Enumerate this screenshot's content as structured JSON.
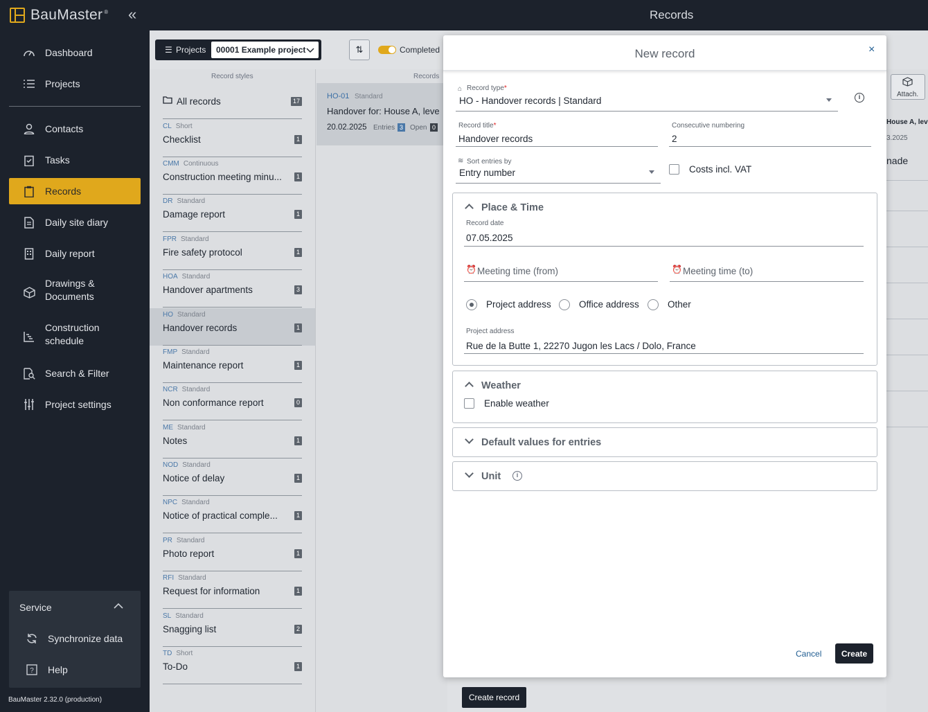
{
  "app": {
    "name": "BauMaster",
    "page_title": "Records",
    "version": "BauMaster 2.32.0 (production)"
  },
  "sidebar": {
    "items": [
      {
        "label": "Dashboard",
        "icon": "gauge-icon"
      },
      {
        "label": "Projects",
        "icon": "list-icon"
      },
      {
        "label": "Contacts",
        "icon": "person-icon"
      },
      {
        "label": "Tasks",
        "icon": "clipboard-check-icon"
      },
      {
        "label": "Records",
        "icon": "clipboard-icon",
        "active": true
      },
      {
        "label": "Daily site diary",
        "icon": "document-icon"
      },
      {
        "label": "Daily report",
        "icon": "building-icon"
      },
      {
        "label": "Drawings &",
        "label2": "Documents",
        "icon": "cube-icon"
      },
      {
        "label": "Construction",
        "label2": "schedule",
        "icon": "chart-icon"
      },
      {
        "label": "Search & Filter",
        "icon": "search-document-icon"
      },
      {
        "label": "Project settings",
        "icon": "sliders-icon"
      }
    ],
    "service": {
      "title": "Service",
      "items": [
        {
          "label": "Synchronize data"
        },
        {
          "label": "Help"
        }
      ]
    }
  },
  "toolbar": {
    "projects_label": "Projects",
    "project_value": "00001 Example project",
    "completed_label": "Completed"
  },
  "columns": {
    "styles_header": "Record styles",
    "records_header": "Records"
  },
  "record_styles": [
    {
      "code": "",
      "kind": "",
      "name": "All records",
      "count": "17"
    },
    {
      "code": "CL",
      "kind": "Short",
      "name": "Checklist",
      "count": "1"
    },
    {
      "code": "CMM",
      "kind": "Continuous",
      "name": "Construction meeting minu...",
      "count": "1"
    },
    {
      "code": "DR",
      "kind": "Standard",
      "name": "Damage report",
      "count": "1"
    },
    {
      "code": "FPR",
      "kind": "Standard",
      "name": "Fire safety protocol",
      "count": "1"
    },
    {
      "code": "HOA",
      "kind": "Standard",
      "name": "Handover apartments",
      "count": "3"
    },
    {
      "code": "HO",
      "kind": "Standard",
      "name": "Handover records",
      "count": "1"
    },
    {
      "code": "FMP",
      "kind": "Standard",
      "name": "Maintenance report",
      "count": "1"
    },
    {
      "code": "NCR",
      "kind": "Standard",
      "name": "Non conformance report",
      "count": "0"
    },
    {
      "code": "ME",
      "kind": "Standard",
      "name": "Notes",
      "count": "1"
    },
    {
      "code": "NOD",
      "kind": "Standard",
      "name": "Notice of delay",
      "count": "1"
    },
    {
      "code": "NPC",
      "kind": "Standard",
      "name": "Notice of practical comple...",
      "count": "1"
    },
    {
      "code": "PR",
      "kind": "Standard",
      "name": "Photo report",
      "count": "1"
    },
    {
      "code": "RFI",
      "kind": "Standard",
      "name": "Request for information",
      "count": "1"
    },
    {
      "code": "SL",
      "kind": "Standard",
      "name": "Snagging list",
      "count": "2"
    },
    {
      "code": "TD",
      "kind": "Short",
      "name": "To-Do",
      "count": "1"
    }
  ],
  "record_card": {
    "code": "HO-01",
    "kind": "Standard",
    "title": "Handover for: House A, leve",
    "date": "20.02.2025",
    "entries_label": "Entries",
    "entries": "3",
    "open_label": "Open",
    "open": "0"
  },
  "right_panel": {
    "attach_label": "Attach.",
    "text1": "House A, leve",
    "text2": "3.2025",
    "text3": "nade"
  },
  "create_record_button": "Create record",
  "modal": {
    "title": "New record",
    "record_type_label": "Record type",
    "record_type_value": "HO - Handover records | Standard",
    "record_title_label": "Record title",
    "record_title_value": "Handover records",
    "consecutive_label": "Consecutive numbering",
    "consecutive_value": "2",
    "sort_label": "Sort entries by",
    "sort_value": "Entry number",
    "costs_label": "Costs incl. VAT",
    "place_time": {
      "title": "Place & Time",
      "record_date_label": "Record date",
      "record_date_value": "07.05.2025",
      "time_from_placeholder": "Meeting time (from)",
      "time_to_placeholder": "Meeting time (to)",
      "address_options": [
        "Project address",
        "Office address",
        "Other"
      ],
      "address_label": "Project address",
      "address_value": "Rue de la Butte 1, 22270 Jugon les Lacs / Dolo, France"
    },
    "weather": {
      "title": "Weather",
      "enable_label": "Enable weather"
    },
    "defaults_title": "Default values for entries",
    "unit_title": "Unit",
    "cancel_label": "Cancel",
    "create_label": "Create"
  }
}
